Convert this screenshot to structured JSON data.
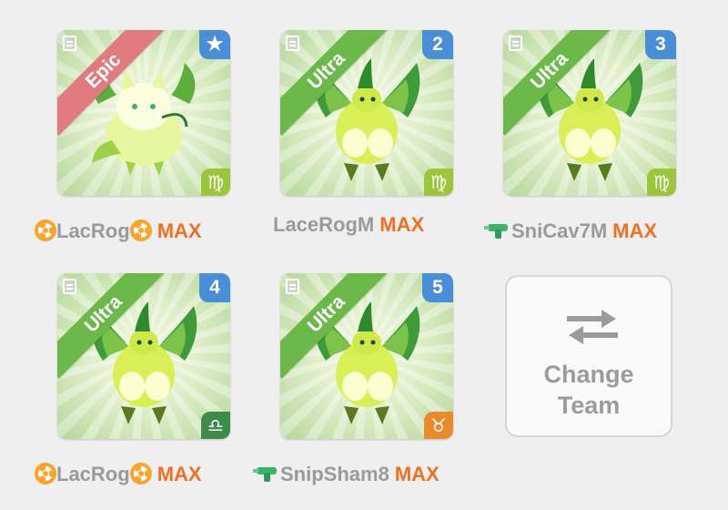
{
  "slots": [
    {
      "rarity": "Epic",
      "position": "★",
      "zodiac": "♍",
      "name": "LacRog",
      "level": "MAX"
    },
    {
      "rarity": "Ultra",
      "position": "2",
      "zodiac": "♍",
      "name": "LaceRogM",
      "level": "MAX"
    },
    {
      "rarity": "Ultra",
      "position": "3",
      "zodiac": "♍",
      "name": "SniCav7M",
      "level": "MAX"
    },
    {
      "rarity": "Ultra",
      "position": "4",
      "zodiac": "♎",
      "name": "LacRog",
      "level": "MAX"
    },
    {
      "rarity": "Ultra",
      "position": "5",
      "zodiac": "♉",
      "name": "SnipSham8",
      "level": "MAX"
    }
  ],
  "change_team": {
    "label": "Change\nTeam"
  },
  "colors": {
    "epic_ribbon": "#e07b80",
    "ultra_ribbon": "#6cb84a",
    "position_badge": "#4a8ed8",
    "max_text": "#ee7025",
    "name_text": "#9a9a9a"
  },
  "icons": {
    "note": "note-icon",
    "nuclear": "nuclear-icon",
    "water_gun": "water-gun-icon",
    "swap": "swap-arrows-icon",
    "star": "star-icon"
  }
}
